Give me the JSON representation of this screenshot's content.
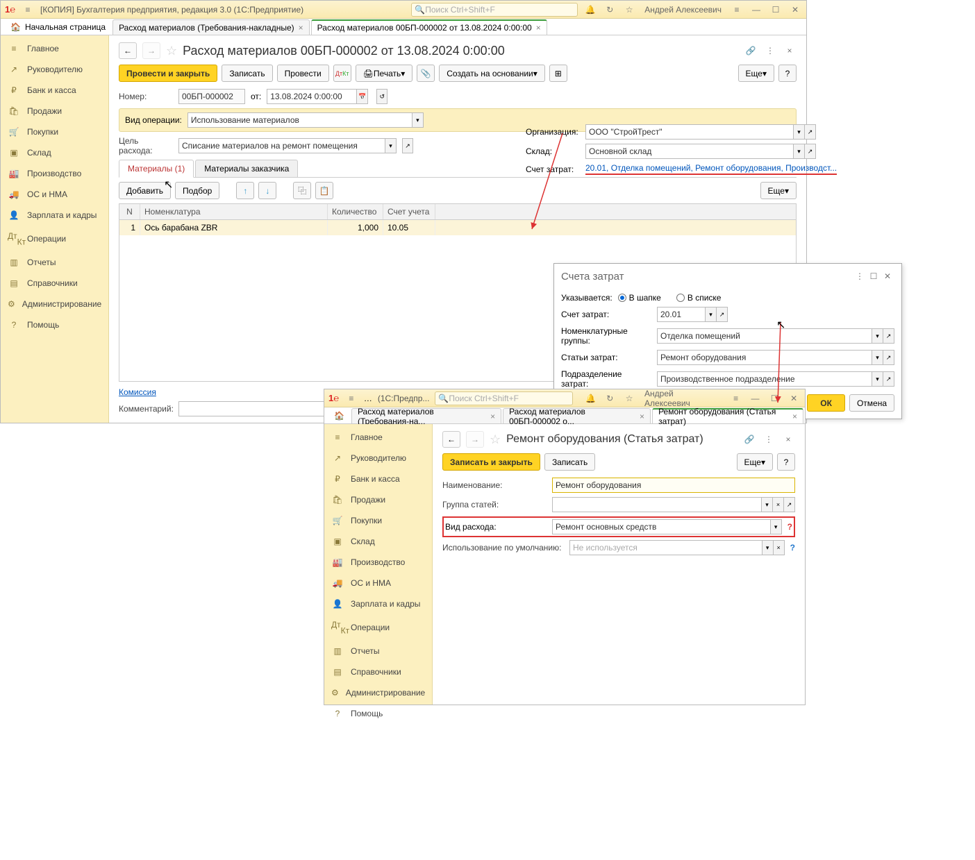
{
  "w1": {
    "title": "[КОПИЯ] Бухгалтерия предприятия, редакция 3.0  (1С:Предприятие)",
    "search_ph": "Поиск Ctrl+Shift+F",
    "user": "Андрей Алексеевич",
    "tabs": {
      "home": "Начальная страница",
      "t1": "Расход материалов (Требования-накладные)",
      "t2": "Расход материалов 00БП-000002 от 13.08.2024 0:00:00"
    },
    "sidebar": [
      "Главное",
      "Руководителю",
      "Банк и касса",
      "Продажи",
      "Покупки",
      "Склад",
      "Производство",
      "ОС и НМА",
      "Зарплата и кадры",
      "Операции",
      "Отчеты",
      "Справочники",
      "Администрирование",
      "Помощь"
    ],
    "page_title": "Расход материалов 00БП-000002 от 13.08.2024 0:00:00",
    "buttons": {
      "post_close": "Провести и закрыть",
      "save": "Записать",
      "post": "Провести",
      "print": "Печать",
      "create_based": "Создать на основании",
      "more": "Еще"
    },
    "form": {
      "number_lbl": "Номер:",
      "number": "00БП-000002",
      "from": "от:",
      "date": "13.08.2024  0:00:00",
      "op_lbl": "Вид операции:",
      "op": "Использование материалов",
      "purpose_lbl": "Цель расхода:",
      "purpose": "Списание материалов на ремонт помещения",
      "org_lbl": "Организация:",
      "org": "ООО \"СтройТрест\"",
      "wh_lbl": "Склад:",
      "wh": "Основной склад",
      "acct_lbl": "Счет затрат:",
      "acct_link": "20.01, Отделка помещений, Ремонт оборудования, Производст..."
    },
    "subtabs": {
      "m1": "Материалы (1)",
      "m2": "Материалы заказчика"
    },
    "grid_btn": {
      "add": "Добавить",
      "pick": "Подбор",
      "more": "Еще"
    },
    "grid_head": {
      "n": "N",
      "nom": "Номенклатура",
      "qty": "Количество",
      "acct": "Счет учета"
    },
    "grid_row": {
      "n": "1",
      "nom": "Ось барабана ZBR",
      "qty": "1,000",
      "acct": "10.05"
    },
    "commission": "Комиссия",
    "comment_lbl": "Комментарий:"
  },
  "popup": {
    "title": "Счета затрат",
    "spec_lbl": "Указывается:",
    "r1": "В шапке",
    "r2": "В списке",
    "acct_lbl": "Счет затрат:",
    "acct": "20.01",
    "grp_lbl": "Номенклатурные группы:",
    "grp": "Отделка помещений",
    "item_lbl": "Статьи затрат:",
    "item": "Ремонт оборудования",
    "div_lbl": "Подразделение затрат:",
    "div": "Производственное подразделение",
    "ok": "ОК",
    "cancel": "Отмена"
  },
  "w2": {
    "title": "(1С:Предпр...",
    "search_ph": "Поиск Ctrl+Shift+F",
    "user": "Андрей Алексеевич",
    "tabs": {
      "t1": "Расход материалов (Требования-на...",
      "t2": "Расход материалов 00БП-000002 о...",
      "t3": "Ремонт оборудования (Статья затрат)"
    },
    "sidebar": [
      "Главное",
      "Руководителю",
      "Банк и касса",
      "Продажи",
      "Покупки",
      "Склад",
      "Производство",
      "ОС и НМА",
      "Зарплата и кадры",
      "Операции",
      "Отчеты",
      "Справочники",
      "Администрирование",
      "Помощь"
    ],
    "page_title": "Ремонт оборудования (Статья затрат)",
    "buttons": {
      "save_close": "Записать и закрыть",
      "save": "Записать",
      "more": "Еще"
    },
    "form": {
      "name_lbl": "Наименование:",
      "name": "Ремонт оборудования",
      "grp_lbl": "Группа статей:",
      "grp": "",
      "kind_lbl": "Вид расхода:",
      "kind": "Ремонт основных средств",
      "use_lbl": "Использование по умолчанию:",
      "use_ph": "Не используется"
    }
  }
}
